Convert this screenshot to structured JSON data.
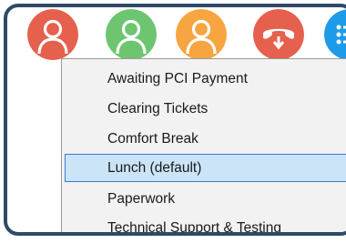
{
  "status_buttons": [
    {
      "name": "red-status",
      "color": "#e5604d",
      "icon": "user-icon"
    },
    {
      "name": "green-status",
      "color": "#6dc56f",
      "icon": "user-icon"
    },
    {
      "name": "orange-status",
      "color": "#f7a541",
      "icon": "user-icon"
    },
    {
      "name": "hangup-status",
      "color": "#e5604d",
      "icon": "phone-hangup-icon"
    },
    {
      "name": "blue-status",
      "color": "#1e9be8",
      "icon": "menu-icon"
    }
  ],
  "menu": {
    "items": [
      {
        "label": "Awaiting PCI Payment",
        "selected": false
      },
      {
        "label": "Clearing Tickets",
        "selected": false
      },
      {
        "label": "Comfort Break",
        "selected": false
      },
      {
        "label": "Lunch (default)",
        "selected": true
      },
      {
        "label": "Paperwork",
        "selected": false
      },
      {
        "label": "Technical Support & Testing",
        "selected": false
      }
    ]
  },
  "colors": {
    "frame_border": "#2e4a66",
    "selection_bg": "#cce4f7",
    "selection_border": "#2f7fd1"
  }
}
